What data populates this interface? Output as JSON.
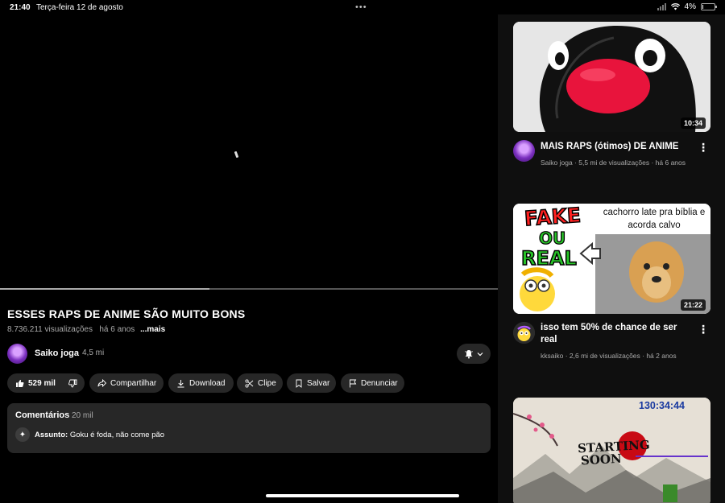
{
  "status_bar": {
    "time": "21:40",
    "date": "Terça-feira 12 de agosto",
    "dots": "•••",
    "battery": "4%"
  },
  "video": {
    "title": "ESSES RAPS DE ANIME SÃO MUITO BONS",
    "views": "8.736.211 visualizações",
    "age": "há 6 anos",
    "more": "...mais",
    "watched_fraction": 0.42
  },
  "channel": {
    "name": "Saiko joga",
    "subscribers": "4,5 mi"
  },
  "actions": {
    "likes": "529 mil",
    "share": "Compartilhar",
    "download": "Download",
    "clip": "Clipe",
    "save": "Salvar",
    "report": "Denunciar"
  },
  "comments": {
    "title": "Comentários",
    "count": "20 mil",
    "topic_label": "Assunto:",
    "topic_text": "Goku é foda, não come pão"
  },
  "recommendations": [
    {
      "title": "MAIS RAPS (ótimos) DE ANIME",
      "channel": "Saiko joga",
      "meta": "Saiko joga · 5,5 mi de visualizações · há 6 anos",
      "duration": "10:34"
    },
    {
      "title": "isso tem 50% de chance de ser real",
      "channel": "kksaiko",
      "meta": "kksaiko · 2,6 mi de visualizações · há 2 anos",
      "duration": "21:22",
      "thumb_text": {
        "fake": "FAKE",
        "ou": "OU",
        "real": "REAL",
        "caption": "cachorro late pra bíblia e acorda calvo"
      }
    },
    {
      "thumb_text": {
        "timer": "130:34:44",
        "starting": "STARTING",
        "soon": "SOON"
      }
    }
  ],
  "colors": {
    "background": "#000000",
    "sidebar": "#0f0f0f",
    "pill": "#272727",
    "secondary_text": "#aaaaaa"
  }
}
